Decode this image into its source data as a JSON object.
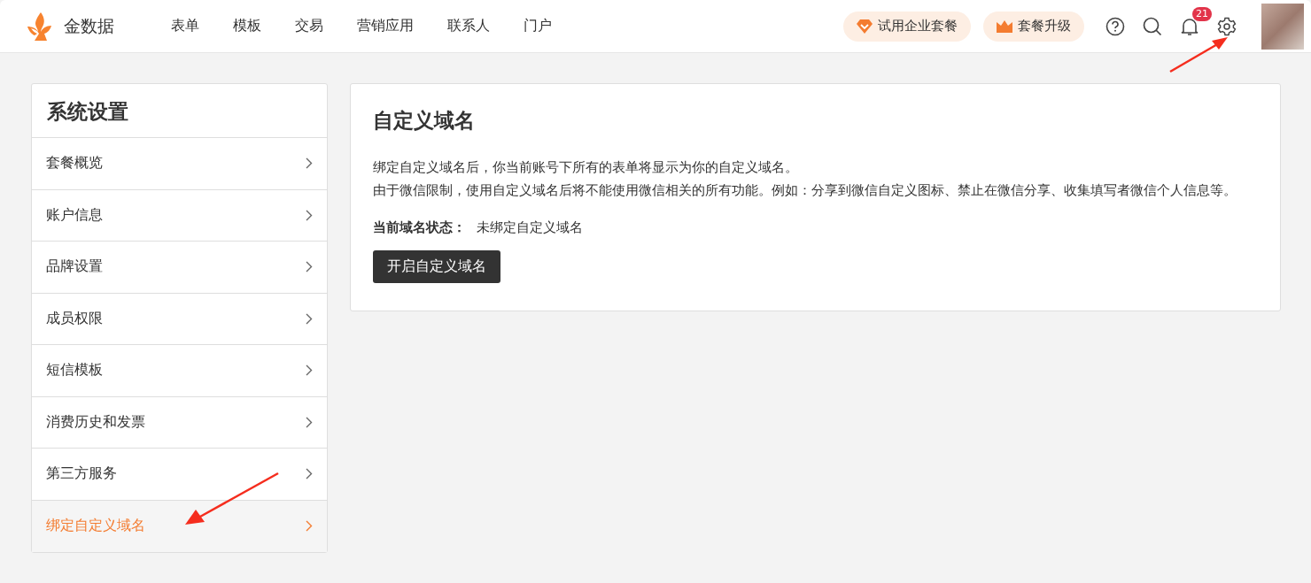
{
  "header": {
    "brand": "金数据",
    "nav": [
      {
        "label": "表单",
        "selected": false
      },
      {
        "label": "模板",
        "selected": false
      },
      {
        "label": "交易",
        "selected": false
      },
      {
        "label": "营销应用",
        "selected": false
      },
      {
        "label": "联系人",
        "selected": false
      },
      {
        "label": "门户",
        "selected": false
      }
    ],
    "trial_button": "试用企业套餐",
    "upgrade_button": "套餐升级",
    "notification_count": "21"
  },
  "sidebar": {
    "title": "系统设置",
    "items": [
      {
        "label": "套餐概览",
        "selected": false
      },
      {
        "label": "账户信息",
        "selected": false
      },
      {
        "label": "品牌设置",
        "selected": false
      },
      {
        "label": "成员权限",
        "selected": false
      },
      {
        "label": "短信模板",
        "selected": false
      },
      {
        "label": "消费历史和发票",
        "selected": false
      },
      {
        "label": "第三方服务",
        "selected": false
      },
      {
        "label": "绑定自定义域名",
        "selected": true
      }
    ]
  },
  "main": {
    "title": "自定义域名",
    "description": [
      "绑定自定义域名后，你当前账号下所有的表单将显示为你的自定义域名。",
      "由于微信限制，使用自定义域名后将不能使用微信相关的所有功能。例如：分享到微信自定义图标、禁止在微信分享、收集填写者微信个人信息等。"
    ],
    "status_label": "当前域名状态：",
    "status_value": "未绑定自定义域名",
    "action_button": "开启自定义域名"
  }
}
